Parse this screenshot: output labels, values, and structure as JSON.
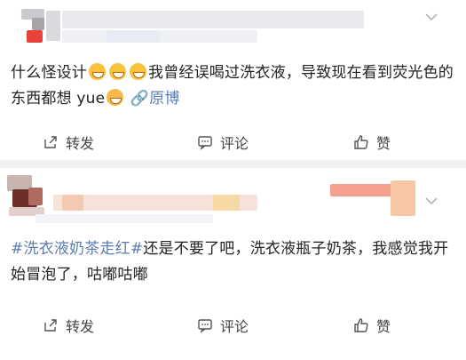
{
  "posts": [
    {
      "text_before_emoji": "什么怪设计",
      "emojis": [
        "grinning-tears-emoji",
        "grinning-tears-emoji",
        "grinning-tears-emoji"
      ],
      "text_after_emoji": "我曾经误喝过洗衣液，导致现在看到荧光色的东西都想 yue",
      "trailing_emoji": "nauseated-face-emoji",
      "link_label": "原博",
      "actions": {
        "share": "转发",
        "comment": "评论",
        "like": "赞"
      }
    },
    {
      "hashtag": "#洗衣液奶茶走红#",
      "text": "还是不要了吧，洗衣液瓶子奶茶，我感觉我开始冒泡了，咕嘟咕嘟",
      "actions": {
        "share": "转发",
        "comment": "评论",
        "like": "赞"
      }
    }
  ],
  "colors": {
    "link": "#5b7db1",
    "divider": "#f2f2f2",
    "text": "#222222"
  }
}
